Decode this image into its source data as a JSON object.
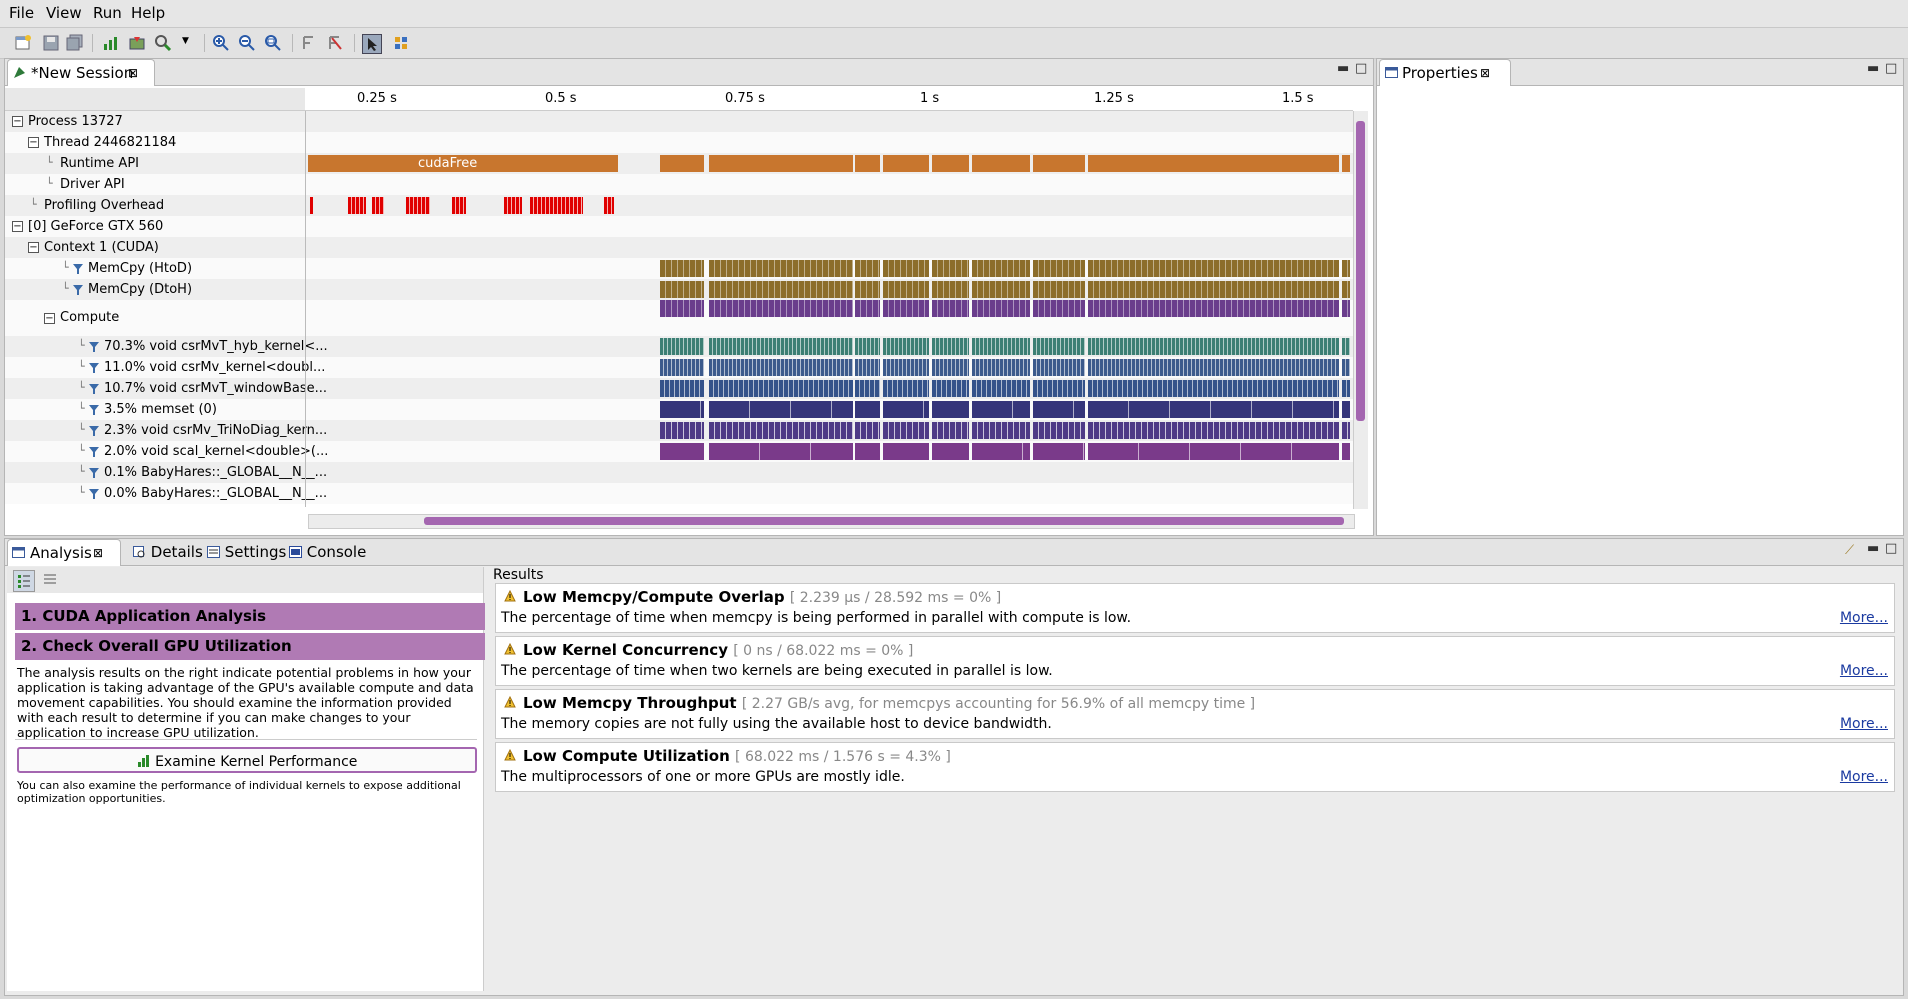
{
  "menu": [
    "File",
    "View",
    "Run",
    "Help"
  ],
  "session_tab": "*New Session",
  "properties_tab": "Properties",
  "ruler": [
    "0.25 s",
    "0.5 s",
    "0.75 s",
    "1 s",
    "1.25 s",
    "1.5 s"
  ],
  "tree": [
    {
      "label": "Process 13727",
      "indent": 0,
      "box": "−"
    },
    {
      "label": "Thread 2446821184",
      "indent": 1,
      "box": "−"
    },
    {
      "label": "Runtime API",
      "indent": 2,
      "box": ""
    },
    {
      "label": "Driver API",
      "indent": 2,
      "box": ""
    },
    {
      "label": "Profiling Overhead",
      "indent": 1,
      "box": ""
    },
    {
      "label": "[0] GeForce GTX 560",
      "indent": 0,
      "box": "−"
    },
    {
      "label": "Context 1 (CUDA)",
      "indent": 1,
      "box": "−"
    },
    {
      "label": "MemCpy (HtoD)",
      "indent": 3,
      "box": "",
      "filter": true
    },
    {
      "label": "MemCpy (DtoH)",
      "indent": 3,
      "box": "",
      "filter": true
    },
    {
      "label": "Compute",
      "indent": 2,
      "box": "−"
    },
    {
      "label": "70.3% void csrMvT_hyb_kernel<...",
      "indent": 4,
      "box": "",
      "filter": true
    },
    {
      "label": "11.0% void csrMv_kernel<doubl...",
      "indent": 4,
      "box": "",
      "filter": true
    },
    {
      "label": "10.7% void csrMvT_windowBase...",
      "indent": 4,
      "box": "",
      "filter": true
    },
    {
      "label": "3.5% memset (0)",
      "indent": 4,
      "box": "",
      "filter": true
    },
    {
      "label": "2.3% void csrMv_TriNoDiag_kern...",
      "indent": 4,
      "box": "",
      "filter": true
    },
    {
      "label": "2.0% void scal_kernel<double>(...",
      "indent": 4,
      "box": "",
      "filter": true
    },
    {
      "label": "0.1% BabyHares::_GLOBAL__N__...",
      "indent": 4,
      "box": "",
      "filter": true
    },
    {
      "label": "0.0% BabyHares::_GLOBAL__N__...",
      "indent": 4,
      "box": "",
      "filter": true
    }
  ],
  "cuda_free_label": "cudaFree",
  "colors": {
    "runtime": "#c8762e",
    "overhead": "#e00000",
    "memcpy": "#8c6d2a",
    "compute": "#6a3d8c",
    "hyb": "#3c7f74",
    "csrmv": "#3c5a8c",
    "window": "#34528a",
    "memset": "#35357a",
    "trinodiag": "#4e3a86",
    "scal": "#7a3a8a",
    "step_bg": "#b07ab4"
  },
  "bottom_tabs": [
    "Analysis",
    "Details",
    "Settings",
    "Console"
  ],
  "steps": [
    "1. CUDA Application Analysis",
    "2. Check Overall GPU Utilization"
  ],
  "step_text": "The analysis results on the right indicate potential problems in how your application is taking advantage of the GPU's available compute and data movement capabilities. You should examine the information provided with each result to determine if you can make changes to your application to increase GPU utilization.",
  "examine_button": "Examine Kernel Performance",
  "examine_text": "You can also examine the performance of individual kernels to expose additional optimization opportunities.",
  "results_label": "Results",
  "results": [
    {
      "title": "Low Memcpy/Compute Overlap",
      "detail": "[ 2.239 µs / 28.592 ms = 0% ]",
      "desc": "The percentage of time when memcpy is being performed in parallel with compute is low.",
      "more": "More..."
    },
    {
      "title": "Low Kernel Concurrency",
      "detail": "[ 0 ns / 68.022 ms = 0% ]",
      "desc": "The percentage of time when two kernels are being executed in parallel is low.",
      "more": "More..."
    },
    {
      "title": "Low Memcpy Throughput",
      "detail": "[ 2.27 GB/s avg, for memcpys accounting for 56.9% of all memcpy time ]",
      "desc": "The memory copies are not fully using the available host to device bandwidth.",
      "more": "More..."
    },
    {
      "title": "Low Compute Utilization",
      "detail": "[ 68.022 ms / 1.576 s = 4.3% ]",
      "desc": "The multiprocessors of one or more GPUs are mostly idle.",
      "more": "More..."
    }
  ]
}
